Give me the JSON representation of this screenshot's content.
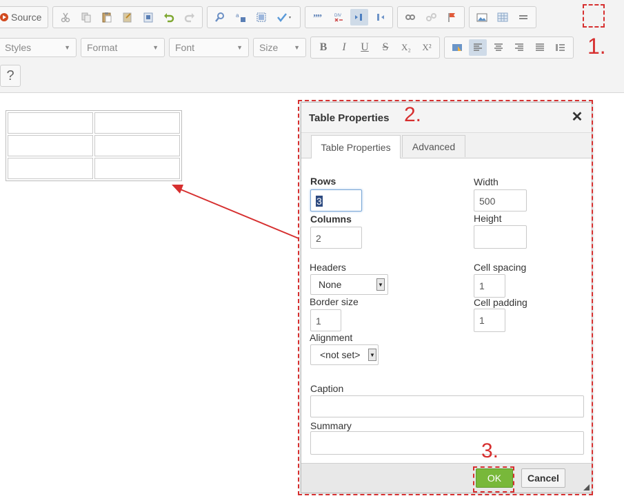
{
  "toolbar": {
    "source_label": "Source",
    "combos": {
      "styles": "Styles",
      "format": "Format",
      "font": "Font",
      "size": "Size"
    },
    "format_buttons": {
      "bold": "B",
      "italic": "I",
      "underline": "U",
      "strike": "S",
      "subscript": "X₂",
      "superscript": "X²"
    },
    "help_label": "?"
  },
  "annotations": {
    "step1": "1.",
    "step2": "2.",
    "step3": "3."
  },
  "dialog": {
    "title": "Table Properties",
    "close_glyph": "✕",
    "tabs": [
      "Table Properties",
      "Advanced"
    ],
    "rows_label": "Rows",
    "rows_value": "3",
    "columns_label": "Columns",
    "columns_value": "2",
    "width_label": "Width",
    "width_value": "500",
    "height_label": "Height",
    "height_value": "",
    "headers_label": "Headers",
    "headers_value": "None",
    "cell_spacing_label": "Cell spacing",
    "cell_spacing_value": "1",
    "border_size_label": "Border size",
    "border_size_value": "1",
    "cell_padding_label": "Cell padding",
    "cell_padding_value": "1",
    "alignment_label": "Alignment",
    "alignment_value": "<not set>",
    "caption_label": "Caption",
    "caption_value": "",
    "summary_label": "Summary",
    "summary_value": "",
    "ok_label": "OK",
    "cancel_label": "Cancel"
  },
  "colors": {
    "annotation_red": "#d62f2f",
    "ok_green": "#78b83a"
  }
}
